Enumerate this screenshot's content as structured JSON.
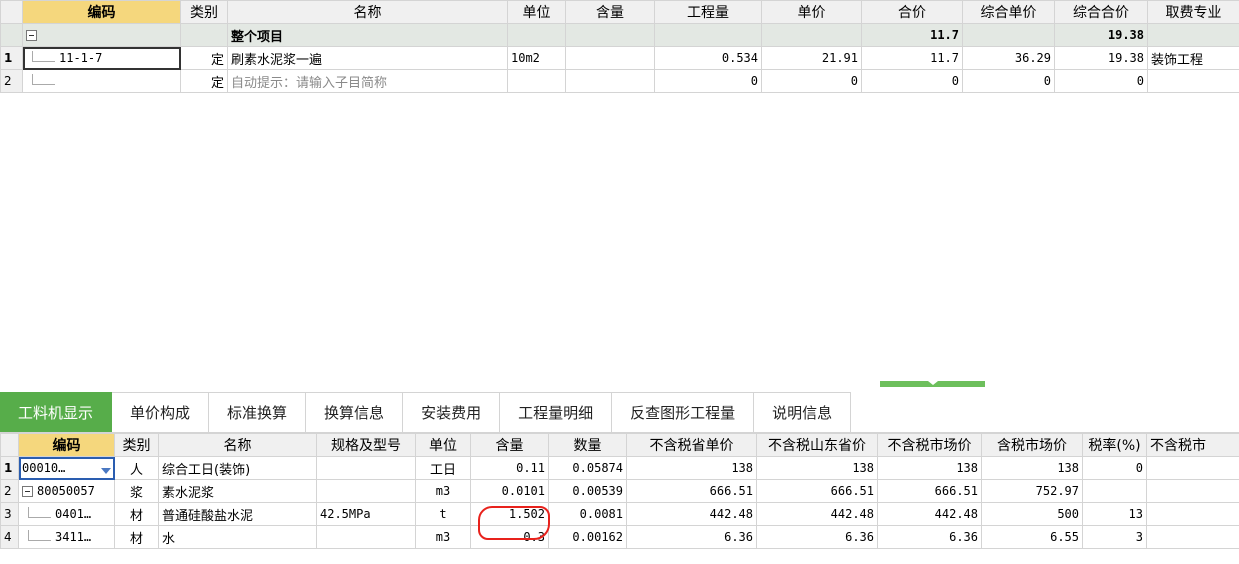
{
  "top": {
    "headers": [
      "编码",
      "类别",
      "名称",
      "单位",
      "含量",
      "工程量",
      "单价",
      "合价",
      "综合单价",
      "综合合价",
      "取费专业"
    ],
    "group": {
      "name": "整个项目",
      "hejia": "11.7",
      "zonghe_hejia": "19.38"
    },
    "rows": [
      {
        "rn": "1",
        "code": "11-1-7",
        "type": "定",
        "name": "刷素水泥浆一遍",
        "unit": "10m2",
        "hanliang": "",
        "gcl": "0.534",
        "danjia": "21.91",
        "hejia": "11.7",
        "zhdj": "36.29",
        "zhhj": "19.38",
        "qufei": "装饰工程"
      },
      {
        "rn": "2",
        "code": "",
        "type": "定",
        "name": "自动提示：请输入子目简称",
        "unit": "",
        "hanliang": "",
        "gcl": "0",
        "danjia": "0",
        "hejia": "0",
        "zhdj": "0",
        "zhhj": "0",
        "qufei": ""
      }
    ]
  },
  "tabs": [
    "工料机显示",
    "单价构成",
    "标准换算",
    "换算信息",
    "安装费用",
    "工程量明细",
    "反查图形工程量",
    "说明信息"
  ],
  "bottom": {
    "headers": [
      "编码",
      "类别",
      "名称",
      "规格及型号",
      "单位",
      "含量",
      "数量",
      "不含税省单价",
      "不含税山东省价",
      "不含税市场价",
      "含税市场价",
      "税率(%)",
      "不含税市"
    ],
    "rows": [
      {
        "rn": "1",
        "code": "00010…",
        "type": "人",
        "name": "综合工日(装饰)",
        "spec": "",
        "unit": "工日",
        "hl": "0.11",
        "qty": "0.05874",
        "p1": "138",
        "p2": "138",
        "p3": "138",
        "p4": "138",
        "tax": "0",
        "x": ""
      },
      {
        "rn": "2",
        "code": "80050057",
        "type": "浆",
        "name": "素水泥浆",
        "spec": "",
        "unit": "m3",
        "hl": "0.0101",
        "qty": "0.00539",
        "p1": "666.51",
        "p2": "666.51",
        "p3": "666.51",
        "p4": "752.97",
        "tax": "",
        "x": ""
      },
      {
        "rn": "3",
        "code": "0401…",
        "type": "材",
        "name": "普通硅酸盐水泥",
        "spec": "42.5MPa",
        "unit": "t",
        "hl": "1.502",
        "qty": "0.0081",
        "p1": "442.48",
        "p2": "442.48",
        "p3": "442.48",
        "p4": "500",
        "tax": "13",
        "x": ""
      },
      {
        "rn": "4",
        "code": "3411…",
        "type": "材",
        "name": "水",
        "spec": "",
        "unit": "m3",
        "hl": "0.3",
        "qty": "0.00162",
        "p1": "6.36",
        "p2": "6.36",
        "p3": "6.36",
        "p4": "6.55",
        "tax": "3",
        "x": ""
      }
    ]
  },
  "colors": {
    "tab_active": "#57ad4a",
    "header_code": "#f5d77d",
    "annotation": "#e8221c"
  }
}
